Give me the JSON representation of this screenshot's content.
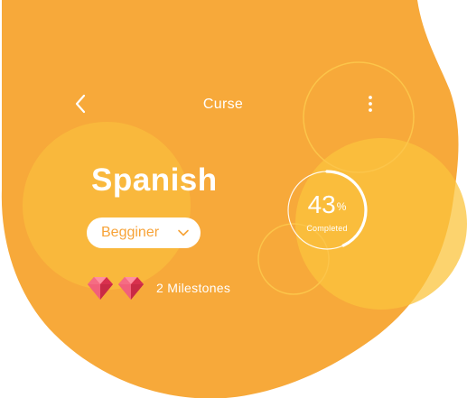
{
  "header": {
    "back_icon": "chevron-left-icon",
    "title": "Curse",
    "menu_icon": "more-vertical-icon"
  },
  "course": {
    "name": "Spanish",
    "level": {
      "selected": "Begginer",
      "icon": "chevron-down-icon"
    },
    "milestones": {
      "icon": "gem-icon",
      "icon_count": 2,
      "label": "2 Milestones"
    },
    "progress": {
      "value": 43,
      "percent_sign": "%",
      "label": "Completed"
    }
  },
  "colors": {
    "background": "#ffffff",
    "primary": "#f7a338",
    "accent_circle": "#fbc43e",
    "gem": "#ec4f69",
    "text_on_primary": "#ffffff"
  }
}
